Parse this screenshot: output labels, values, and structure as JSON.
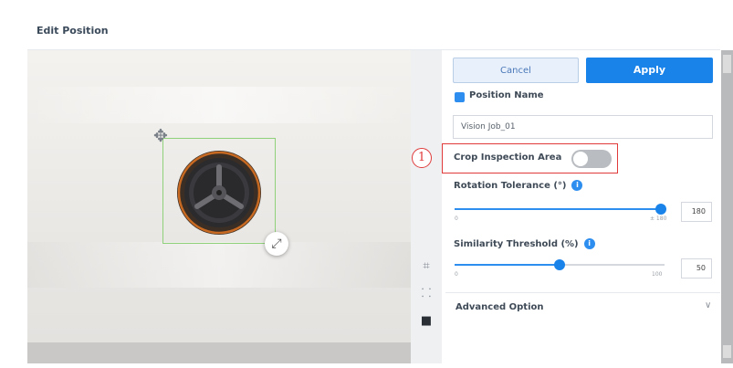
{
  "dialog": {
    "title": "Edit Position"
  },
  "toolstrip": {
    "tools": [
      {
        "icon": "fit-view-icon",
        "glyph": "⌗"
      },
      {
        "icon": "grid-icon",
        "glyph": "⸬"
      },
      {
        "icon": "toolbox-icon",
        "glyph": "■"
      }
    ]
  },
  "actions": {
    "cancel_label": "Cancel",
    "apply_label": "Apply"
  },
  "position_name": {
    "label": "Position Name",
    "value": "Vision Job_01"
  },
  "crop": {
    "callout": "1",
    "label": "Crop Inspection Area",
    "enabled": false
  },
  "rotation": {
    "label": "Rotation Tolerance (°)",
    "min_label": "0",
    "max_label": "± 180",
    "value": "180",
    "fraction": 1.0
  },
  "similarity": {
    "label": "Similarity Threshold (%)",
    "min_label": "0",
    "max_label": "100",
    "value": "50",
    "fraction": 0.5
  },
  "advanced": {
    "label": "Advanced Option",
    "chevron": "∨"
  },
  "colors": {
    "accent": "#1a83ea",
    "highlight": "#e03a3a",
    "selection": "#8fd07a"
  }
}
